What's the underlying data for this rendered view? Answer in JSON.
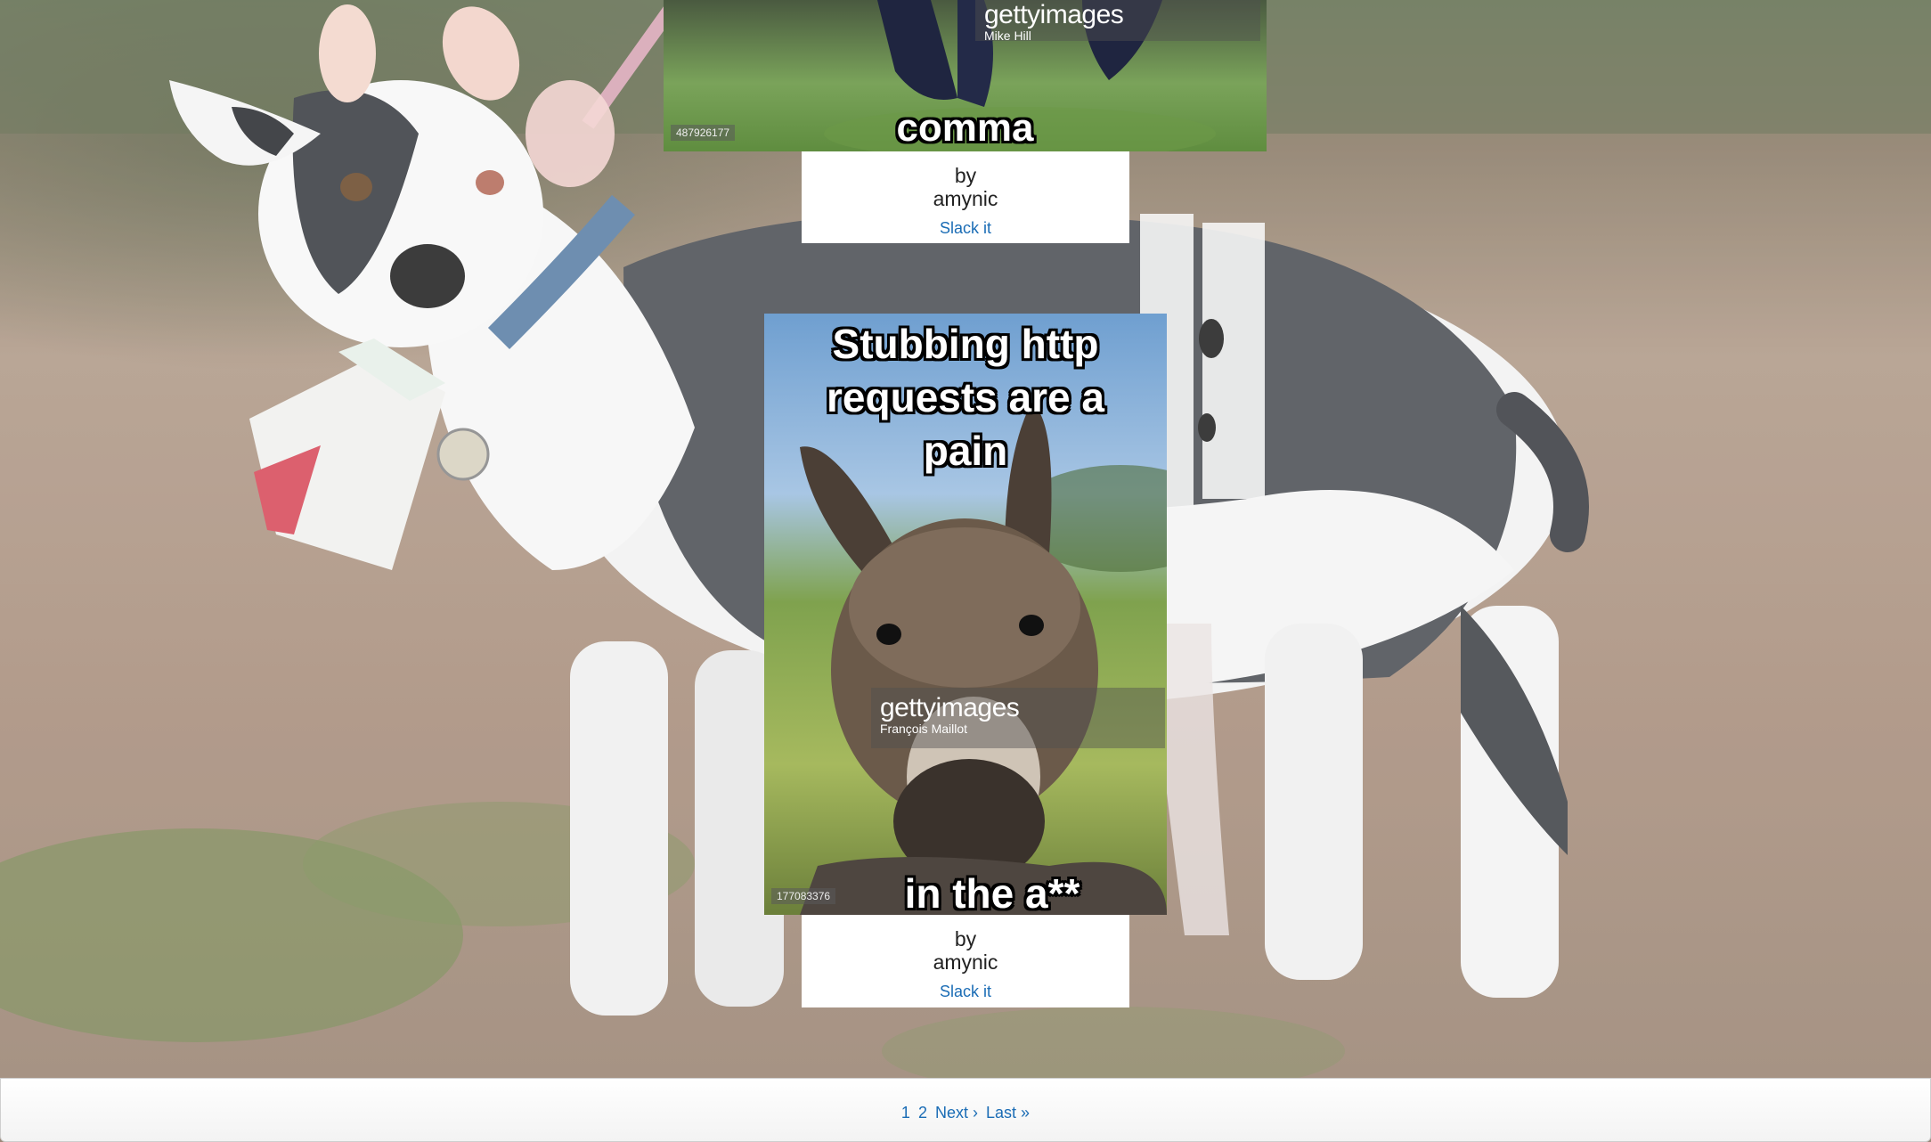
{
  "memes": [
    {
      "caption_top": "",
      "caption_bottom": "comma",
      "watermark_brand": "gettyimages",
      "watermark_credit": "Mike Hill",
      "image_id": "487926177",
      "by_label": "by",
      "author": "amynic",
      "action_label": "Slack it"
    },
    {
      "caption_top": "Stubbing http requests are a pain",
      "caption_bottom": "in the a**",
      "watermark_brand": "gettyimages",
      "watermark_credit": "François Maillot",
      "image_id": "177083376",
      "by_label": "by",
      "author": "amynic",
      "action_label": "Slack it"
    }
  ],
  "pagination": {
    "page_1": "1",
    "page_2": "2",
    "next": "Next ›",
    "last": "Last »"
  },
  "colors": {
    "link": "#1a6cb5",
    "card_background": "#ffffff"
  }
}
